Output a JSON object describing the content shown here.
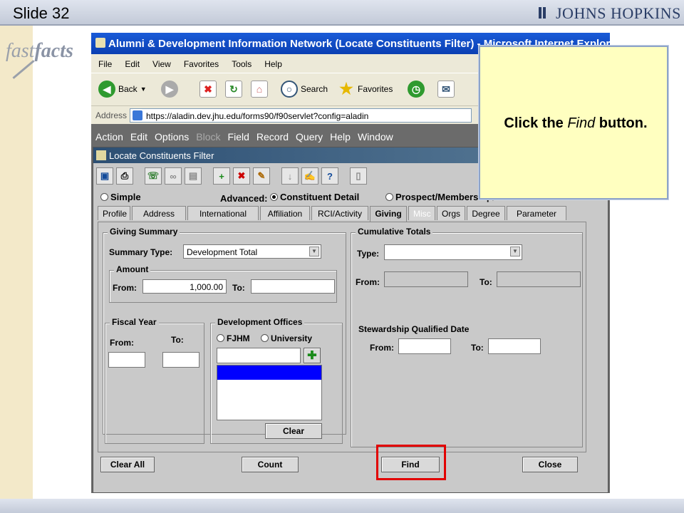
{
  "slide": {
    "number_label": "Slide 32",
    "brand": "JOHNS HOPKINS",
    "logo_fast": "fast",
    "logo_facts": "facts"
  },
  "browser": {
    "title": "Alumni & Development Information Network (Locate Constituents Filter) - Microsoft Internet Explorer",
    "menu": [
      "File",
      "Edit",
      "View",
      "Favorites",
      "Tools",
      "Help"
    ],
    "back_label": "Back",
    "search_label": "Search",
    "favorites_label": "Favorites",
    "address_label": "Address",
    "url": "https://aladin.dev.jhu.edu/forms90/f90servlet?config=aladin"
  },
  "app": {
    "menu": [
      "Action",
      "Edit",
      "Options",
      "Block",
      "Field",
      "Record",
      "Query",
      "Help",
      "Window"
    ],
    "window_title": "Locate Constituents Filter",
    "radio_simple": "Simple",
    "advanced_label": "Advanced:",
    "radio_constituent": "Constituent Detail",
    "radio_prospect": "Prospect/Membership/Events",
    "tabs": [
      "Profile",
      "Address",
      "International",
      "Affiliation",
      "RCI/Activity",
      "Giving",
      "Misc",
      "Orgs",
      "Degree",
      "Parameter"
    ],
    "giving_summary": {
      "title": "Giving Summary",
      "summary_type_label": "Summary Type:",
      "summary_type_value": "Development Total",
      "amount_title": "Amount",
      "from_label": "From:",
      "from_value": "1,000.00",
      "to_label": "To:",
      "to_value": ""
    },
    "cumulative": {
      "title": "Cumulative Totals",
      "type_label": "Type:",
      "from_label": "From:",
      "to_label": "To:"
    },
    "fiscal_year": {
      "title": "Fiscal Year",
      "from_label": "From:",
      "to_label": "To:"
    },
    "dev_offices": {
      "title": "Development Offices",
      "opt_fjhm": "FJHM",
      "opt_university": "University",
      "clear_label": "Clear"
    },
    "stewardship": {
      "title": "Stewardship Qualified Date",
      "from_label": "From:",
      "to_label": "To:"
    },
    "buttons": {
      "clear_all": "Clear All",
      "count": "Count",
      "find": "Find",
      "close": "Close"
    }
  },
  "callout": {
    "prefix": "Click the ",
    "emph": "Find",
    "suffix": " button."
  },
  "colors": {
    "highlight": "#e20000",
    "selection": "#0000ff",
    "callout_bg": "#ffffc0"
  }
}
